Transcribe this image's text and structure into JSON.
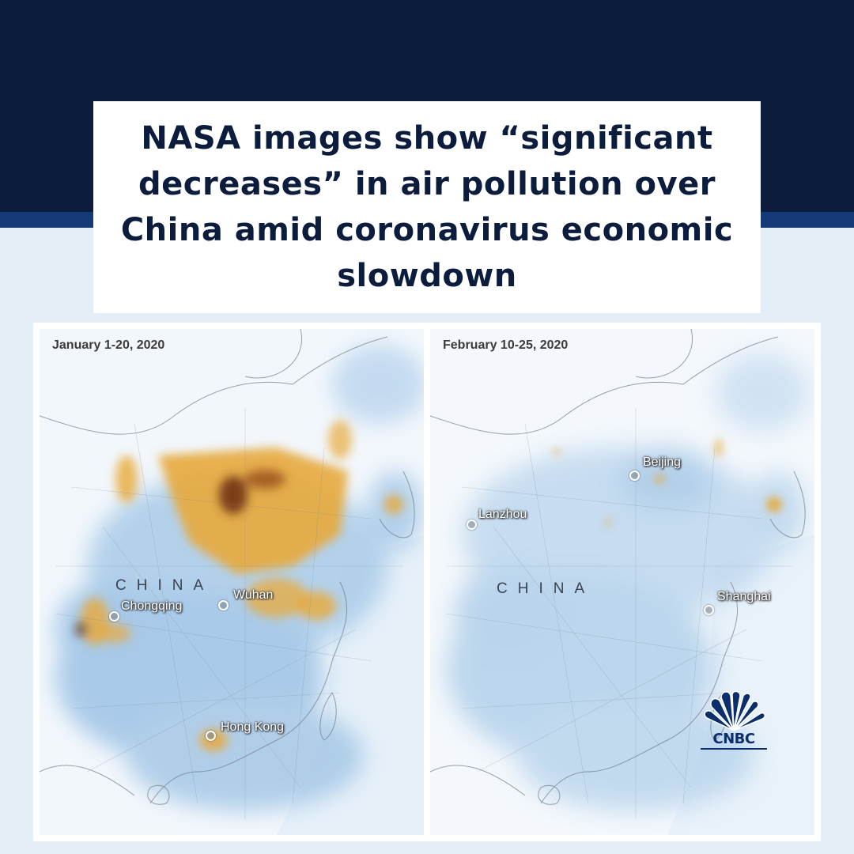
{
  "headline": "NASA images show “significant decreases” in air pollution over China amid coronavirus economic slowdown",
  "maps": [
    {
      "date_label": "January 1-20, 2020",
      "country_label": "CHINA",
      "cities": [
        "Chongqing",
        "Wuhan",
        "Hong Kong"
      ]
    },
    {
      "date_label": "February 10-25, 2020",
      "country_label": "CHINA",
      "cities": [
        "Lanzhou",
        "Beijing",
        "Shanghai"
      ]
    }
  ],
  "logo": {
    "text": "CNBC",
    "icon": "peacock-icon"
  },
  "colors": {
    "header_band": "#0b1c3c",
    "header_stripe": "#143a78",
    "background": "#e3eef7",
    "pollution_high": "#e8a93a",
    "pollution_peak": "#4a1c0a",
    "pollution_low": "#7fb2dc",
    "logo_blue": "#0b2e6d"
  }
}
